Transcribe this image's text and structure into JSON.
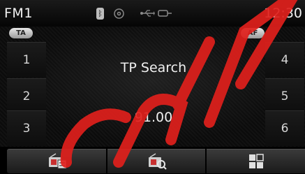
{
  "status_bar": {
    "band": "FM1",
    "clock": "12:30",
    "icons": [
      "bluetooth-icon",
      "disc-icon",
      "usb-icon",
      "aux-icon"
    ]
  },
  "toggles": {
    "ta_label": "TA",
    "af_label": "AF"
  },
  "presets": {
    "left": [
      "1",
      "2",
      "3"
    ],
    "right": [
      "4",
      "5",
      "6"
    ]
  },
  "display": {
    "status_text": "TP Search",
    "frequency": "91.00"
  },
  "soft_keys": [
    {
      "icon": "radio-list-icon"
    },
    {
      "icon": "radio-scan-icon"
    },
    {
      "icon": "menu-grid-icon"
    }
  ],
  "colors": {
    "watermark": "#e0201c",
    "accent_red": "#c81c1c"
  }
}
